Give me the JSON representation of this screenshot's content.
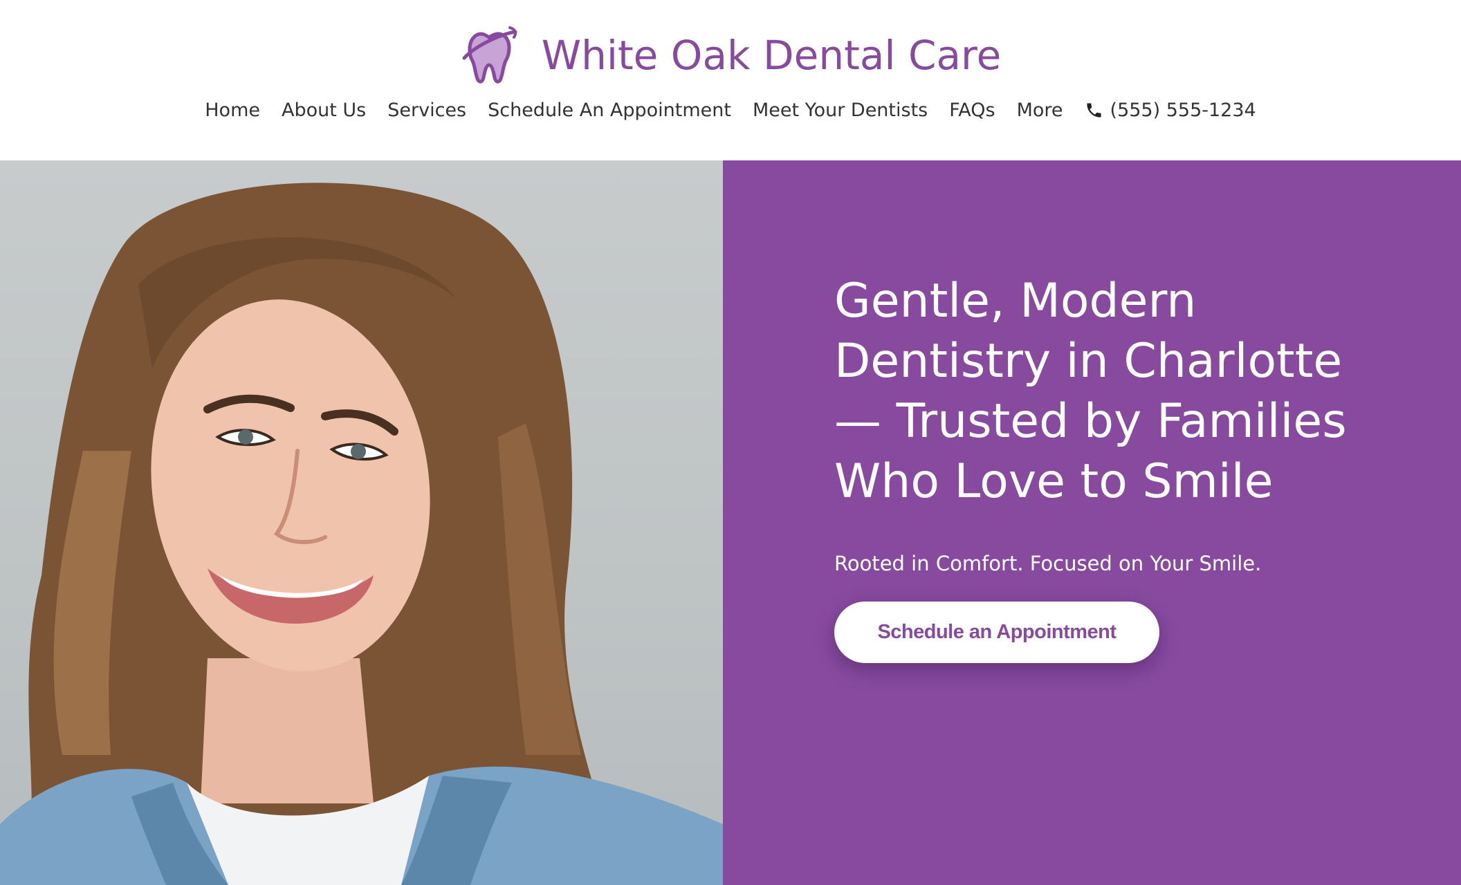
{
  "brand": {
    "name": "White Oak Dental Care",
    "logo_icon": "tooth-icon",
    "accent_color": "#874a9f"
  },
  "nav": {
    "items": [
      {
        "label": "Home"
      },
      {
        "label": "About Us"
      },
      {
        "label": "Services"
      },
      {
        "label": "Schedule An Appointment"
      },
      {
        "label": "Meet Your Dentists"
      },
      {
        "label": "FAQs"
      },
      {
        "label": "More"
      }
    ],
    "phone": {
      "icon": "phone-icon",
      "number": "(555) 555-1234"
    }
  },
  "hero": {
    "title": "Gentle, Modern Dentistry in Charlotte — Trusted by Families Who Love to Smile",
    "subtitle": "Rooted in Comfort. Focused on Your Smile.",
    "cta_label": "Schedule an Appointment",
    "image": "smiling-woman-photo",
    "panel_color": "#874a9f"
  }
}
